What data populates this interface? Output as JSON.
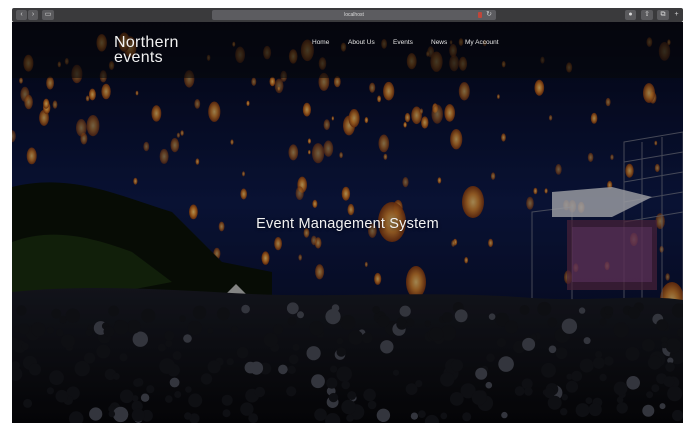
{
  "browser": {
    "url": "localhost",
    "reload_icon": "reload-icon"
  },
  "nav": {
    "brand_line1": "Northern",
    "brand_line2": "events",
    "links": [
      "Home",
      "About Us",
      "Events",
      "News",
      "My Account"
    ]
  },
  "hero": {
    "title": "Event Management System"
  },
  "colors": {
    "sky_top": "#06081a",
    "sky_mid": "#0c1540",
    "lantern": "#f0a040",
    "overlay": "#000000"
  }
}
